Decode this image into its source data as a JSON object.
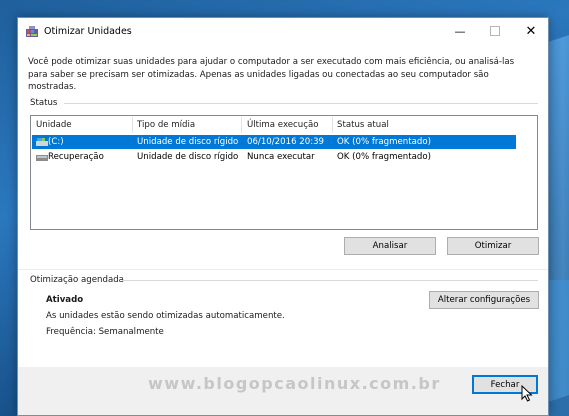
{
  "window": {
    "title": "Otimizar Unidades",
    "minimize_symbol": "—",
    "close_symbol": "✕",
    "icon": "defrag-app-icon"
  },
  "description": "Você pode otimizar suas unidades para ajudar o computador a ser executado com mais eficiência, ou analisá-las para saber se precisam ser otimizadas. Apenas as unidades ligadas ou conectadas ao seu computador são mostradas.",
  "status": {
    "label": "Status",
    "columns": [
      "Unidade",
      "Tipo de mídia",
      "Última execução",
      "Status atual"
    ],
    "rows": [
      {
        "drive": "(C:)",
        "media": "Unidade de disco rígido",
        "last_run": "06/10/2016 20:39",
        "status": "OK (0% fragmentado)",
        "selected": true,
        "icon": "system-drive-icon"
      },
      {
        "drive": "Recuperação",
        "media": "Unidade de disco rígido",
        "last_run": "Nunca executar",
        "status": "OK (0% fragmentado)",
        "selected": false,
        "icon": "hard-drive-icon"
      }
    ],
    "analyze_label": "Analisar",
    "optimize_label": "Otimizar"
  },
  "scheduled": {
    "label": "Otimização agendada",
    "state": "Ativado",
    "info": "As unidades estão sendo otimizadas automaticamente.",
    "frequency": "Frequência: Semanalmente",
    "change_settings_label": "Alterar configurações"
  },
  "footer": {
    "close_label": "Fechar",
    "watermark": "www.blogopcaolinux.com.br"
  },
  "colors": {
    "selection": "#0078d7",
    "desktop": "#1f5f9c"
  }
}
